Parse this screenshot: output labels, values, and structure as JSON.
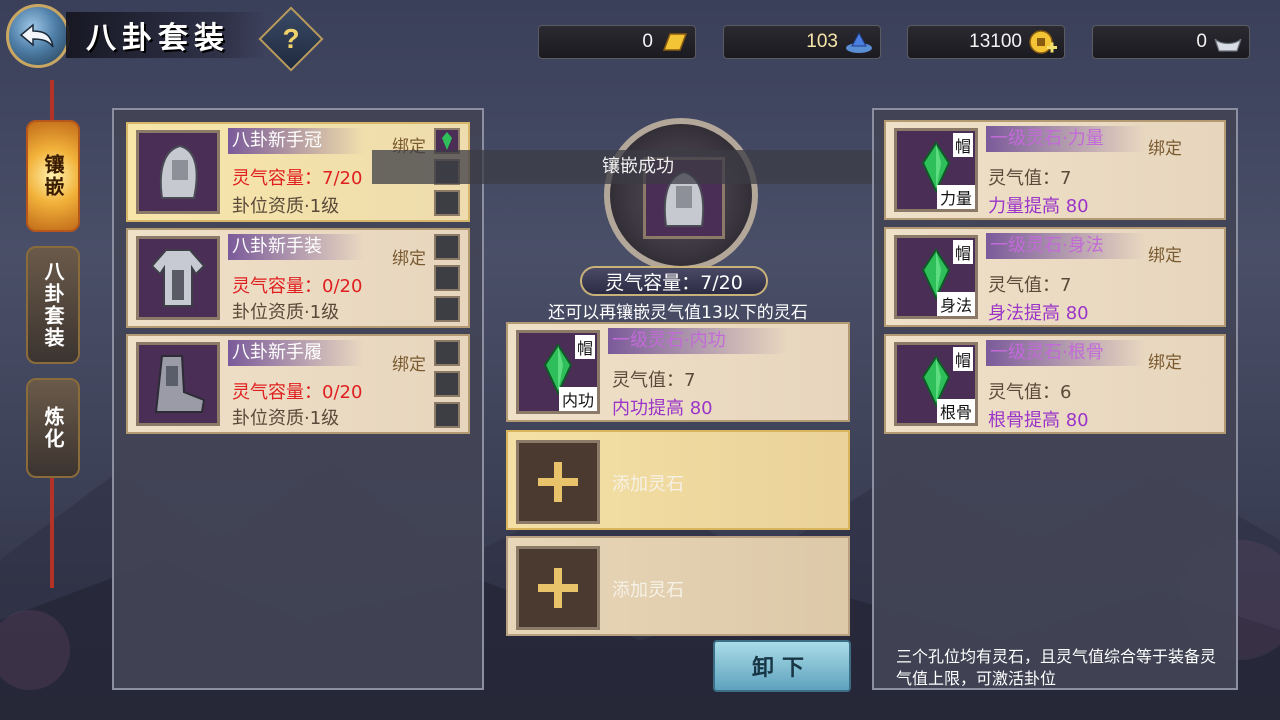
{
  "header": {
    "title": "八卦套装",
    "help_icon": "question-icon"
  },
  "currencies": [
    {
      "value": "0",
      "icon": "gold-ingot-icon"
    },
    {
      "value": "103",
      "icon": "blue-gem-icon"
    },
    {
      "value": "13100",
      "icon": "coin-plus-icon"
    },
    {
      "value": "0",
      "icon": "silver-ingot-icon"
    }
  ],
  "side_tabs": [
    {
      "label": "镶嵌",
      "active": true
    },
    {
      "label": "八卦套装",
      "active": false
    },
    {
      "label": "炼化",
      "active": false
    }
  ],
  "equipment": [
    {
      "name": "八卦新手冠",
      "bind": "绑定",
      "capacity": "灵气容量：7/20",
      "quality": "卦位资质·1级",
      "selected": true
    },
    {
      "name": "八卦新手装",
      "bind": "绑定",
      "capacity": "灵气容量：0/20",
      "quality": "卦位资质·1级",
      "selected": false
    },
    {
      "name": "八卦新手履",
      "bind": "绑定",
      "capacity": "灵气容量：0/20",
      "quality": "卦位资质·1级",
      "selected": false
    }
  ],
  "center": {
    "toast": "镶嵌成功",
    "capacity": "灵气容量：7/20",
    "hint": "还可以再镶嵌灵气值13以下的灵石",
    "socketed_stone": {
      "badge": "帽",
      "tag": "内功",
      "name": "一级灵石·内功",
      "value": "灵气值：7",
      "bonus": "内功提高  80"
    },
    "add_slots": [
      {
        "label": "添加灵石"
      },
      {
        "label": "添加灵石"
      }
    ],
    "unload_button": "卸下"
  },
  "stones": [
    {
      "badge": "帽",
      "tag": "力量",
      "name": "一级灵石·力量",
      "bind": "绑定",
      "value": "灵气值：7",
      "bonus": "力量提高  80"
    },
    {
      "badge": "帽",
      "tag": "身法",
      "name": "一级灵石·身法",
      "bind": "绑定",
      "value": "灵气值：7",
      "bonus": "身法提高  80"
    },
    {
      "badge": "帽",
      "tag": "根骨",
      "name": "一级灵石·根骨",
      "bind": "绑定",
      "value": "灵气值：6",
      "bonus": "根骨提高  80"
    }
  ],
  "footer_note": "三个孔位均有灵石，且灵气值综合等于装备灵气值上限，可激活卦位"
}
